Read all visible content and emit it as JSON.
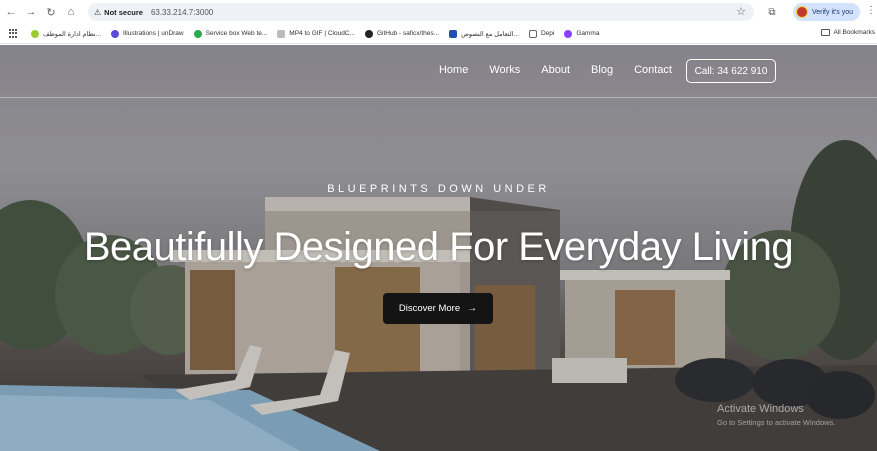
{
  "browser": {
    "security_label": "Not secure",
    "url": "63.33.214.7:3000",
    "profile_chip": "Verify it's you"
  },
  "bookmarks": {
    "items": [
      {
        "label": "نظام ادارة الموظف...",
        "color": "#9acd32"
      },
      {
        "label": "Illustrations | unDraw",
        "color": "#5b4bdb"
      },
      {
        "label": "Service box Web te...",
        "color": "#2fa84f"
      },
      {
        "label": "MP4 to GIF | CloudC...",
        "color": "#bbbbbb"
      },
      {
        "label": "GitHub - saficx/thes...",
        "color": "#222222"
      },
      {
        "label": "التعامل مع النصوص...",
        "color": "#1f4fb0"
      },
      {
        "label": "Depi",
        "color": "#666666"
      },
      {
        "label": "Gamma",
        "color": "#8a3ffc"
      }
    ],
    "all_label": "All Bookmarks"
  },
  "site": {
    "nav": [
      "Home",
      "Works",
      "About",
      "Blog",
      "Contact"
    ],
    "contact_button": "Call: 34 622 910",
    "eyebrow": "BLUEPRINTS DOWN UNDER",
    "headline": "Beautifully Designed For Everyday Living",
    "cta": "Discover More"
  },
  "watermark": {
    "title": "Activate Windows",
    "subtitle": "Go to Settings to activate Windows."
  }
}
